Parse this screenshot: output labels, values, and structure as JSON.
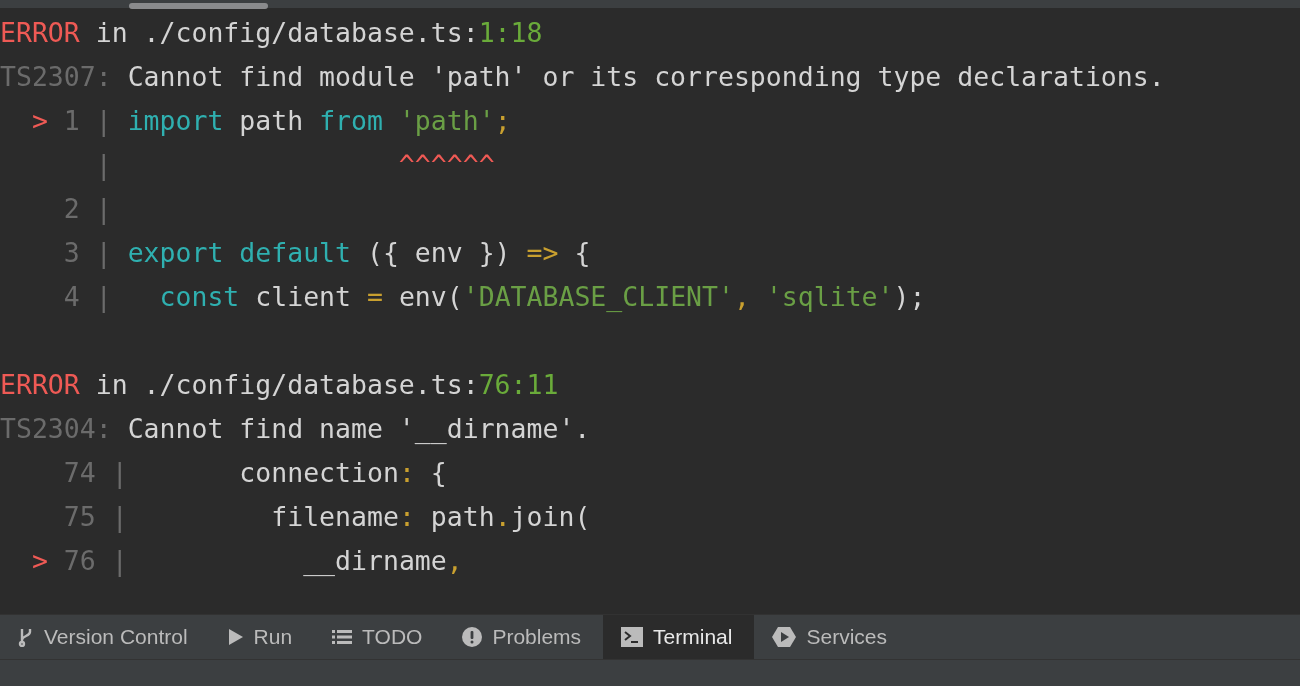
{
  "terminal": {
    "errors": [
      {
        "lines": [
          {
            "segments": [
              {
                "text": "ERROR",
                "kind": "error"
              },
              {
                "text": " in ./config/database.ts:",
                "kind": "path"
              },
              {
                "text": "1:18",
                "kind": "location"
              }
            ]
          },
          {
            "segments": [
              {
                "text": "TS2307:",
                "kind": "dim"
              },
              {
                "text": " Cannot find module 'path' or its corresponding type declarations.",
                "kind": "plain"
              }
            ]
          },
          {
            "segments": [
              {
                "text": "  >",
                "kind": "error"
              },
              {
                "text": " 1 | ",
                "kind": "dim"
              },
              {
                "text": "import",
                "kind": "keyword"
              },
              {
                "text": " path ",
                "kind": "plain"
              },
              {
                "text": "from ",
                "kind": "keyword"
              },
              {
                "text": "'path'",
                "kind": "string"
              },
              {
                "text": ";",
                "kind": "punct"
              }
            ]
          },
          {
            "segments": [
              {
                "text": "      |",
                "kind": "dim"
              },
              {
                "text": "                  ^^^^^^",
                "kind": "error"
              }
            ]
          },
          {
            "segments": [
              {
                "text": "    2 |",
                "kind": "dim"
              }
            ]
          },
          {
            "segments": [
              {
                "text": "    3 | ",
                "kind": "dim"
              },
              {
                "text": "export default",
                "kind": "keyword"
              },
              {
                "text": " ({ env }) ",
                "kind": "plain"
              },
              {
                "text": "=>",
                "kind": "punct"
              },
              {
                "text": " {",
                "kind": "plain"
              }
            ]
          },
          {
            "segments": [
              {
                "text": "    4 |   ",
                "kind": "dim"
              },
              {
                "text": "const",
                "kind": "keyword"
              },
              {
                "text": " client ",
                "kind": "plain"
              },
              {
                "text": "=",
                "kind": "punct"
              },
              {
                "text": " env(",
                "kind": "plain"
              },
              {
                "text": "'DATABASE_CLIENT'",
                "kind": "string"
              },
              {
                "text": ", ",
                "kind": "punct"
              },
              {
                "text": "'sqlite'",
                "kind": "string"
              },
              {
                "text": ");",
                "kind": "plain"
              }
            ]
          }
        ]
      },
      {
        "lines": [
          {
            "segments": [
              {
                "text": "ERROR",
                "kind": "error"
              },
              {
                "text": " in ./config/database.ts:",
                "kind": "path"
              },
              {
                "text": "76:11",
                "kind": "location"
              }
            ]
          },
          {
            "segments": [
              {
                "text": "TS2304:",
                "kind": "dim"
              },
              {
                "text": " Cannot find name '__dirname'.",
                "kind": "plain"
              }
            ]
          },
          {
            "segments": [
              {
                "text": "    74 |       ",
                "kind": "dim"
              },
              {
                "text": "connection",
                "kind": "plain"
              },
              {
                "text": ":",
                "kind": "punct"
              },
              {
                "text": " {",
                "kind": "plain"
              }
            ]
          },
          {
            "segments": [
              {
                "text": "    75 |         ",
                "kind": "dim"
              },
              {
                "text": "filename",
                "kind": "plain"
              },
              {
                "text": ":",
                "kind": "punct"
              },
              {
                "text": " path",
                "kind": "plain"
              },
              {
                "text": ".",
                "kind": "punct"
              },
              {
                "text": "join(",
                "kind": "plain"
              }
            ]
          },
          {
            "segments": [
              {
                "text": "  >",
                "kind": "error"
              },
              {
                "text": " 76 |           ",
                "kind": "dim"
              },
              {
                "text": "__dirname",
                "kind": "plain"
              },
              {
                "text": ",",
                "kind": "punct"
              }
            ]
          }
        ]
      }
    ]
  },
  "tool_tabs": [
    {
      "label": "Version Control",
      "selected": false
    },
    {
      "label": "Run",
      "selected": false
    },
    {
      "label": "TODO",
      "selected": false
    },
    {
      "label": "Problems",
      "selected": false
    },
    {
      "label": "Terminal",
      "selected": true
    },
    {
      "label": "Services",
      "selected": false
    }
  ]
}
